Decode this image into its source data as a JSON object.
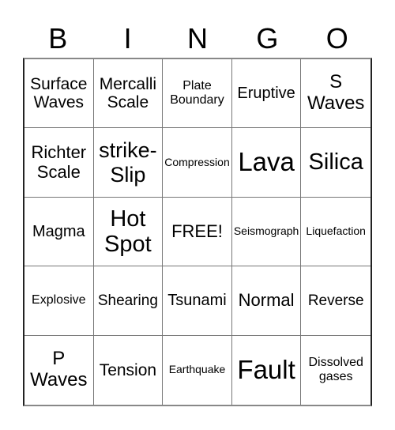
{
  "header": {
    "letters": [
      "B",
      "I",
      "N",
      "G",
      "O"
    ]
  },
  "cells": [
    "Surface Waves",
    "Mercalli Scale",
    "Plate Boundary",
    "Eruptive",
    "S Waves",
    "Richter Scale",
    "strike-Slip",
    "Compression",
    "Lava",
    "Silica",
    "Magma",
    "Hot Spot",
    "FREE!",
    "Seismograph",
    "Liquefaction",
    "Explosive",
    "Shearing",
    "Tsunami",
    "Normal",
    "Reverse",
    "P Waves",
    "Tension",
    "Earthquake",
    "Fault",
    "Dissolved gases"
  ]
}
